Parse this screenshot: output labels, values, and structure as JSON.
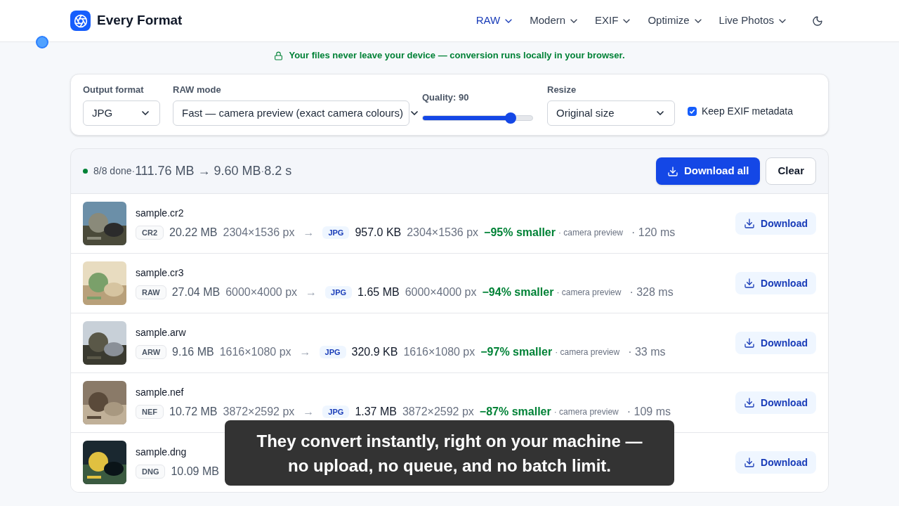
{
  "brand": {
    "name": "Every Format"
  },
  "nav": [
    {
      "label": "RAW",
      "selected": true
    },
    {
      "label": "Modern",
      "selected": false
    },
    {
      "label": "EXIF",
      "selected": false
    },
    {
      "label": "Optimize",
      "selected": false
    },
    {
      "label": "Live Photos",
      "selected": false
    }
  ],
  "privacy_note": "Your files never leave your device — conversion runs locally in your browser.",
  "settings": {
    "output_format": {
      "label": "Output format",
      "value": "JPG"
    },
    "raw_mode": {
      "label": "RAW mode",
      "value": "Fast — camera preview (exact camera colours)"
    },
    "quality": {
      "label": "Quality: 90",
      "level": 0.8
    },
    "resize": {
      "label": "Resize",
      "value": "Original size"
    },
    "keep_exif": {
      "label": "Keep EXIF metadata",
      "checked": true
    }
  },
  "summary": {
    "status": "8/8 done",
    "sep1": "·",
    "sizes": "111.76 MB → 9.60 MB",
    "sep2": "·",
    "time": "8.2 s",
    "download_all": "Download all",
    "clear": "Clear"
  },
  "files": [
    {
      "name": "sample.cr2",
      "in_badge": "CR2",
      "in_size": "20.22 MB",
      "in_dims": "2304×1536 px",
      "arrow": "→",
      "out_badge": "JPG",
      "out_size": "957.0 KB",
      "out_dims": "2304×1536 px",
      "saving": "−95% smaller",
      "mode": "· camera preview",
      "time": "· 120 ms",
      "button": "Download"
    },
    {
      "name": "sample.cr3",
      "in_badge": "RAW",
      "in_size": "27.04 MB",
      "in_dims": "6000×4000 px",
      "arrow": "→",
      "out_badge": "JPG",
      "out_size": "1.65 MB",
      "out_dims": "6000×4000 px",
      "saving": "−94% smaller",
      "mode": "· camera preview",
      "time": "· 328 ms",
      "button": "Download"
    },
    {
      "name": "sample.arw",
      "in_badge": "ARW",
      "in_size": "9.16 MB",
      "in_dims": "1616×1080 px",
      "arrow": "→",
      "out_badge": "JPG",
      "out_size": "320.9 KB",
      "out_dims": "1616×1080 px",
      "saving": "−97% smaller",
      "mode": "· camera preview",
      "time": "· 33 ms",
      "button": "Download"
    },
    {
      "name": "sample.nef",
      "in_badge": "NEF",
      "in_size": "10.72 MB",
      "in_dims": "3872×2592 px",
      "arrow": "→",
      "out_badge": "JPG",
      "out_size": "1.37 MB",
      "out_dims": "3872×2592 px",
      "saving": "−87% smaller",
      "mode": "· camera preview",
      "time": "· 109 ms",
      "button": "Download"
    },
    {
      "name": "sample.dng",
      "in_badge": "DNG",
      "in_size": "10.09 MB",
      "button": "Download"
    }
  ],
  "caption": "They convert instantly, right on your machine — no upload, no queue, and no batch limit."
}
